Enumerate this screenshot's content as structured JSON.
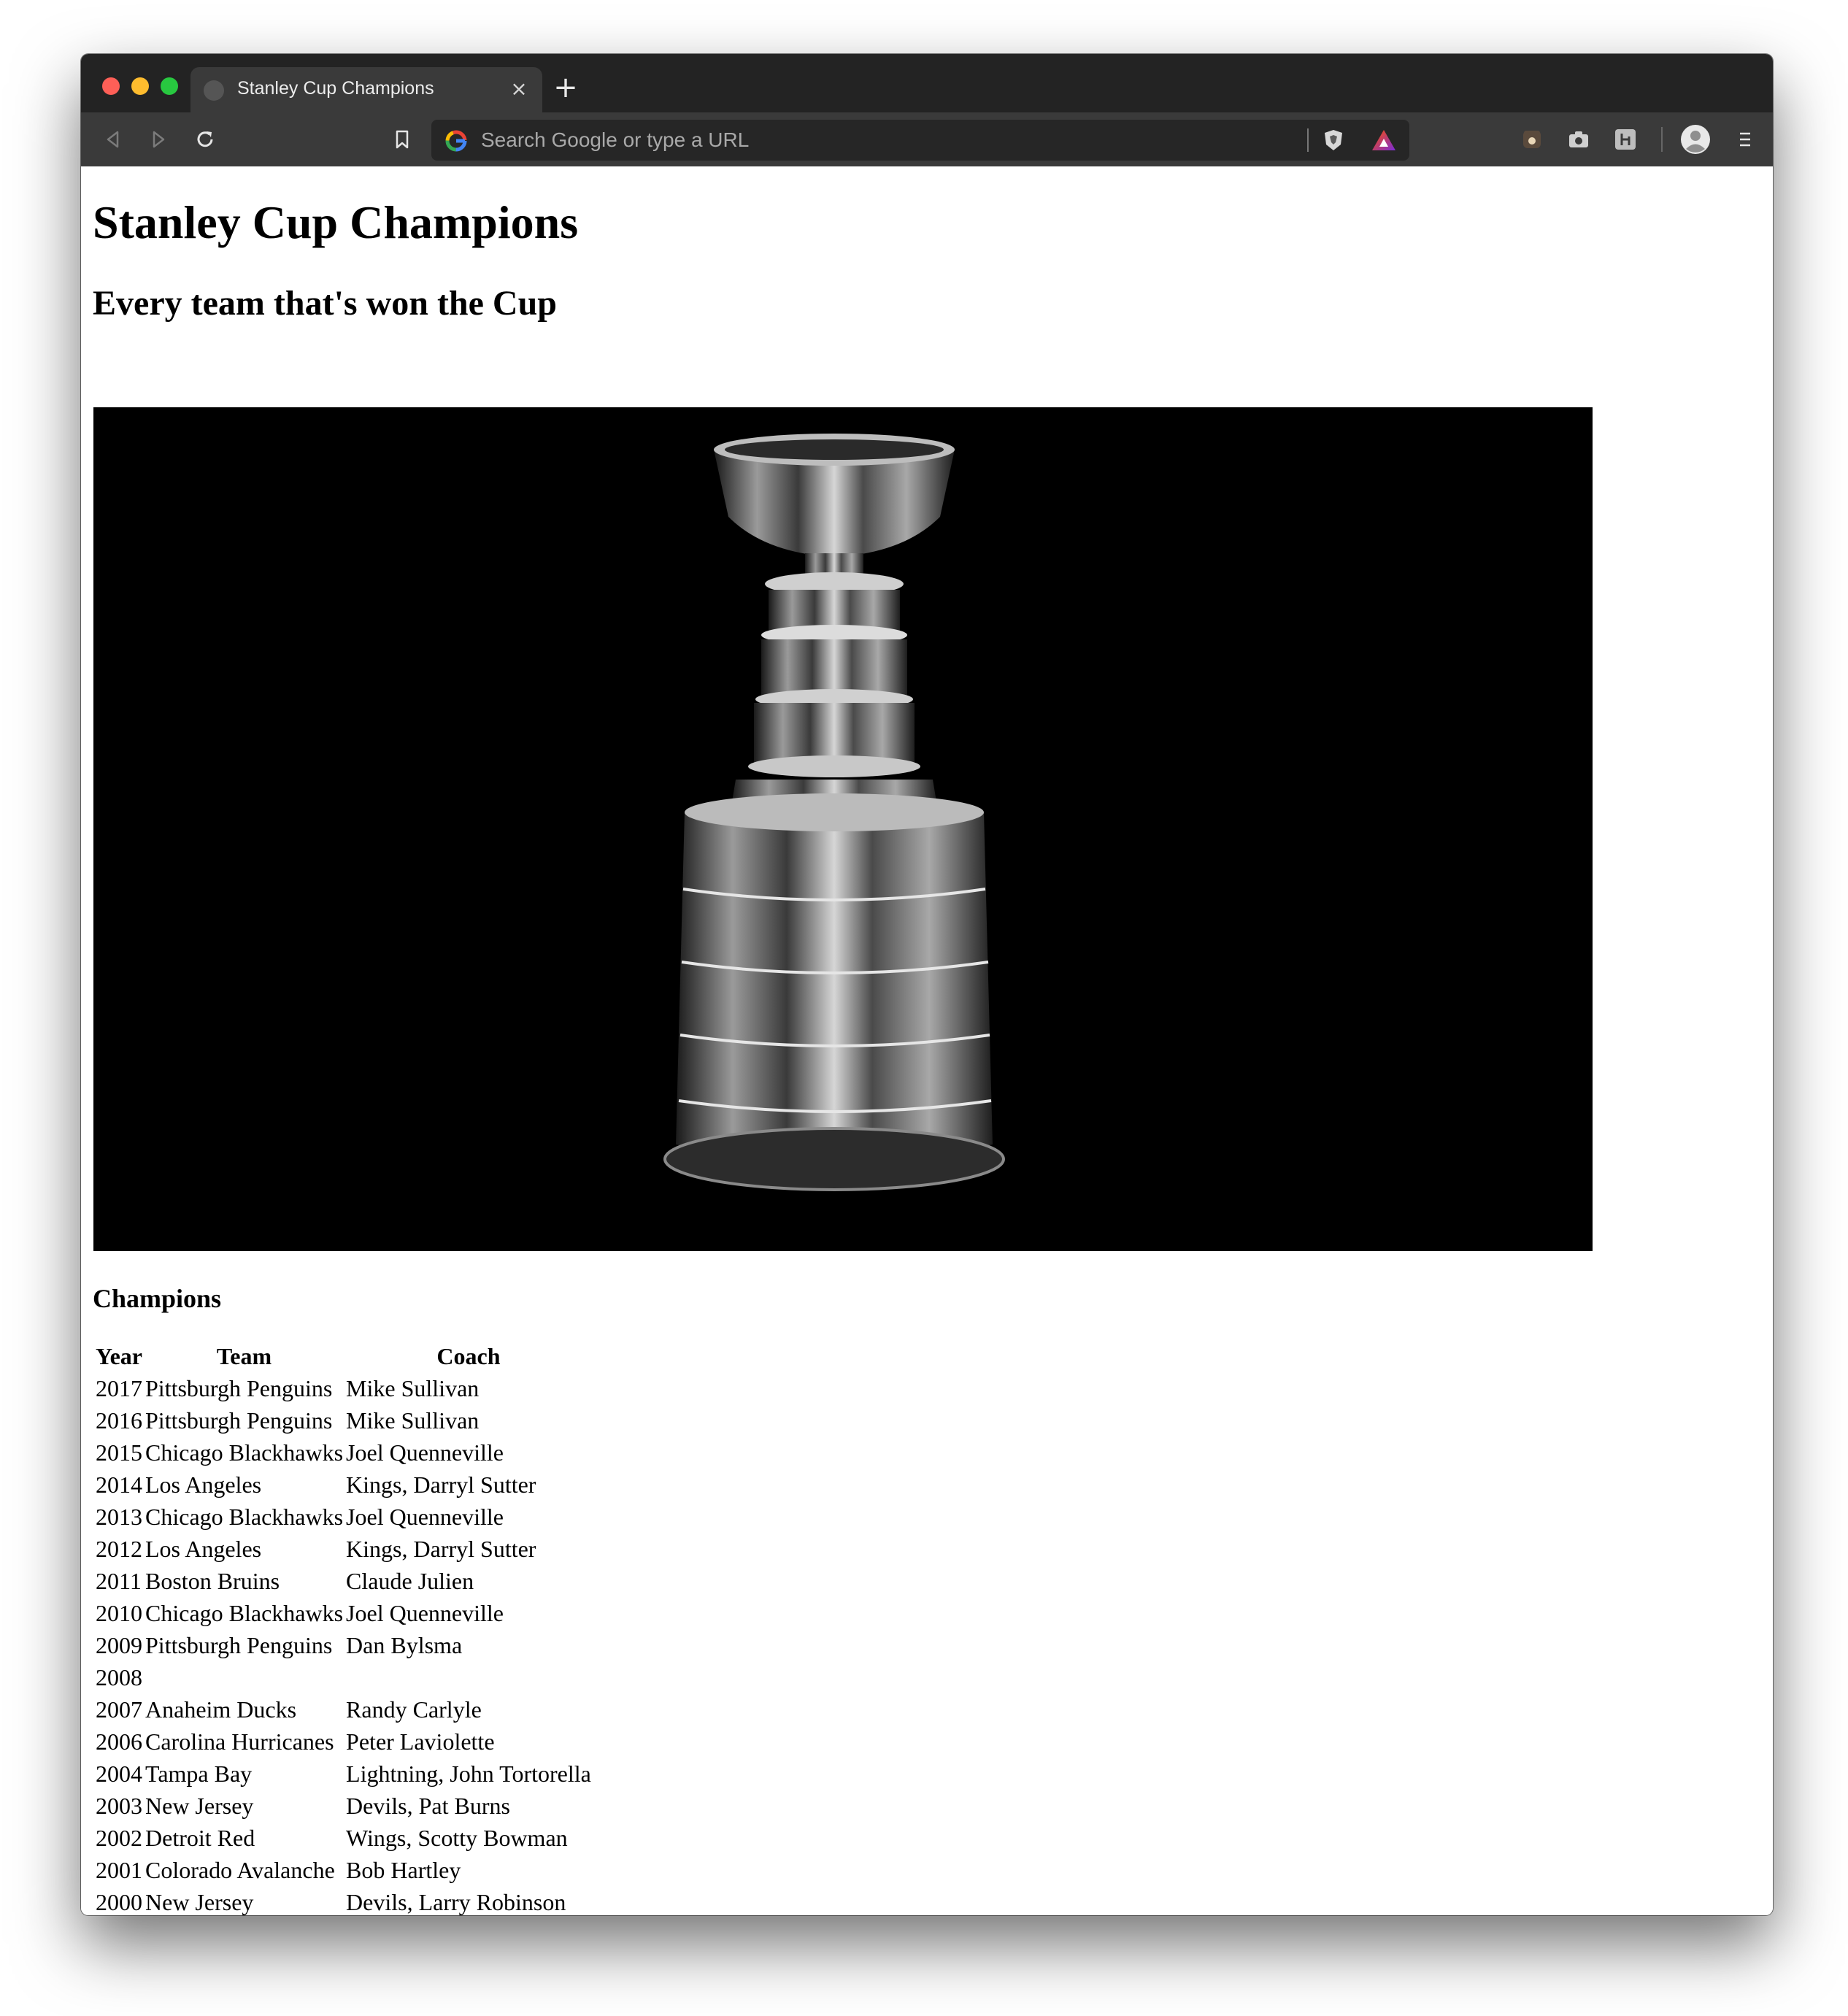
{
  "browser": {
    "tab_title": "Stanley Cup Champions",
    "close_glyph": "×",
    "new_tab_glyph": "+",
    "omnibox_placeholder": "Search Google or type a URL"
  },
  "page": {
    "title": "Stanley Cup Champions",
    "subtitle": "Every team that's won the Cup",
    "section_title": "Champions",
    "table_headers": [
      "Year",
      "Team",
      "Coach"
    ],
    "rows": [
      [
        "2017",
        "Pittsburgh Penguins",
        "Mike Sullivan"
      ],
      [
        "2016",
        "Pittsburgh Penguins",
        "Mike Sullivan"
      ],
      [
        "2015",
        "Chicago Blackhawks",
        "Joel Quenneville"
      ],
      [
        "2014",
        "Los Angeles",
        "Kings, Darryl Sutter"
      ],
      [
        "2013",
        "Chicago Blackhawks",
        "Joel Quenneville"
      ],
      [
        "2012",
        "Los Angeles",
        "Kings, Darryl Sutter"
      ],
      [
        "2011",
        "Boston Bruins",
        "Claude Julien"
      ],
      [
        "2010",
        "Chicago Blackhawks",
        "Joel Quenneville"
      ],
      [
        "2009",
        "Pittsburgh Penguins",
        "Dan Bylsma"
      ],
      [
        "2008",
        "",
        ""
      ],
      [
        "2007",
        "Anaheim Ducks",
        "Randy Carlyle"
      ],
      [
        "2006",
        "Carolina Hurricanes",
        "Peter Laviolette"
      ],
      [
        "2004",
        "Tampa Bay",
        "Lightning, John Tortorella"
      ],
      [
        "2003",
        "New Jersey",
        "Devils, Pat Burns"
      ],
      [
        "2002",
        "Detroit Red",
        "Wings, Scotty Bowman"
      ],
      [
        "2001",
        "Colorado Avalanche",
        "Bob Hartley"
      ],
      [
        "2000",
        "New Jersey",
        "Devils, Larry Robinson"
      ]
    ]
  },
  "colors": {
    "tabbar": "#232323",
    "toolbar": "#3a3a3a",
    "traffic_red": "#fe5f57",
    "traffic_yellow": "#febc2e",
    "traffic_green": "#28c840"
  }
}
